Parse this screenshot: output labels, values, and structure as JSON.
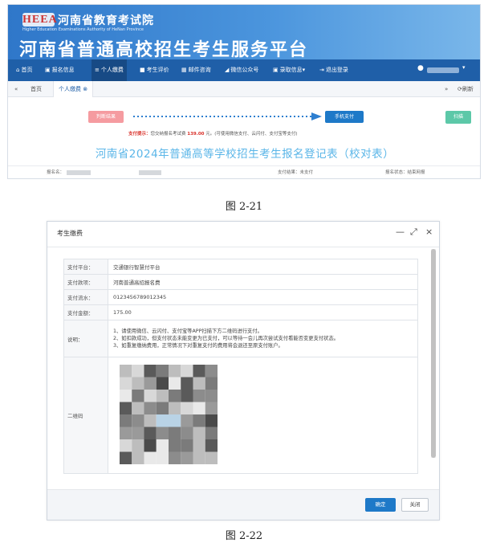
{
  "figure1": {
    "header": {
      "logo_text": "HEEA",
      "org_name": "河南省教育考试院",
      "org_name_en": "Higher Education Examinations Authority of HeNan Province",
      "platform_title": "河南省普通高校招生考生服务平台"
    },
    "nav": {
      "items": [
        {
          "icon": "home-icon",
          "label": "首页"
        },
        {
          "icon": "id-card-icon",
          "label": "报名信息"
        },
        {
          "icon": "menu-icon",
          "label": "个人缴费"
        },
        {
          "icon": "file-icon",
          "label": "考生评价"
        },
        {
          "icon": "mail-icon",
          "label": "邮件咨询"
        },
        {
          "icon": "send-icon",
          "label": "微信公众号"
        },
        {
          "icon": "card-icon",
          "label": "录取信息"
        },
        {
          "icon": "logout-icon",
          "label": "退出登录"
        }
      ],
      "dropdown_caret": "▾",
      "user_icon": "user-icon"
    },
    "tabs": {
      "back_icon": "«",
      "home_tab": "首页",
      "current_tab": "个人缴费",
      "current_tab_close": "⊗",
      "forward_icon": "»",
      "refresh_label": "刷新"
    },
    "steps": {
      "step1_label": "判断结果",
      "step2_label": "手机支付",
      "print_label": "扫描"
    },
    "pay_tip": {
      "label": "支付提示：",
      "text_a": "您交纳报名考试费",
      "amount": "139.00",
      "text_b": "元。(可使用微信支付、云闪付、支付宝等支付)"
    },
    "reg_title": "河南省2024年普通高等学校招生考生报名登记表（校对表）",
    "info": {
      "name_label": "报名名：",
      "pay_result_label": "支付结果：",
      "pay_result_value": "未支付",
      "reg_status_label": "报名状态：",
      "reg_status_value": "结束网报"
    },
    "caption": "图 2-21"
  },
  "figure2": {
    "modal_title": "考生缴费",
    "window_controls": {
      "minimize": "—",
      "maximize": "⤢",
      "close": "×"
    },
    "rows": [
      {
        "label": "支付平台：",
        "value": "交通银行智慧付平台"
      },
      {
        "label": "支付款项：",
        "value": "河南普通高招报名费"
      },
      {
        "label": "支付流水：",
        "value": "0123456789012345"
      },
      {
        "label": "支付金额：",
        "value": "175.00"
      }
    ],
    "note_label": "说明：",
    "notes": [
      "1、请使用微信、云闪付、支付宝等APP扫描下方二维码进行支付。",
      "2、如扣款成功，但支付状态未能变更为已支付，可以等待一会儿再次尝试支付看能否变更支付状态。",
      "3、如重复缴纳费用，正常情况下对重复支付的费用将会退还至原支付账户。"
    ],
    "qr_label": "二维码",
    "confirm_label": "确定",
    "close_label": "关闭",
    "caption": "图 2-22"
  }
}
